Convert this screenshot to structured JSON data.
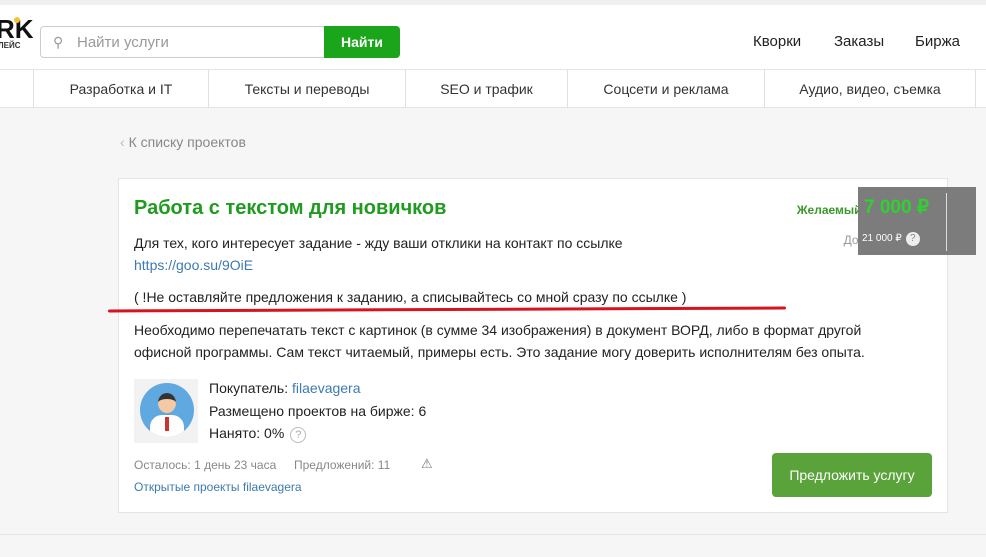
{
  "header": {
    "logo_main": "RK",
    "logo_sub": "ЛЕЙС",
    "search_placeholder": "Найти услуги",
    "search_button": "Найти",
    "nav": [
      "Кворки",
      "Заказы",
      "Биржа"
    ]
  },
  "categories": [
    "Разработка и IT",
    "Тексты и переводы",
    "SEO и трафик",
    "Соцсети и реклама",
    "Аудио, видео, съемка"
  ],
  "back_link": "К списку проектов",
  "project": {
    "title": "Работа с текстом для новичков",
    "desc_line1": "Для тех, кого интересует задание - жду ваши отклики на контакт по ссылке",
    "link": "https://goo.su/9OiE",
    "notice": "( !Не оставляйте предложения к заданию, а списывайтесь со мной сразу по ссылке )",
    "desc_line2": "Необходимо перепечатать текст с картинок (в сумме 34 изображения) в документ ВОРД, либо в формат другой",
    "desc_line3": "офисной программы. Сам текст читаемый, примеры есть. Это задание могу доверить исполнителям без опыта.",
    "budget_label": "Желаемый бюджет: до",
    "budget_value": "7 000 ₽",
    "allowed_label": "Допустимый: до",
    "allowed_value": "21 000 ₽",
    "buyer_label": "Покупатель:",
    "buyer_name": "filaevagera",
    "posted": "Размещено проектов на бирже: 6",
    "hired": "Нанято: 0%",
    "remaining": "Осталось: 1 день 23 часа",
    "offers": "Предложений: 11",
    "open_projects": "Открытые проекты filaevagera",
    "offer_button": "Предложить услугу"
  }
}
